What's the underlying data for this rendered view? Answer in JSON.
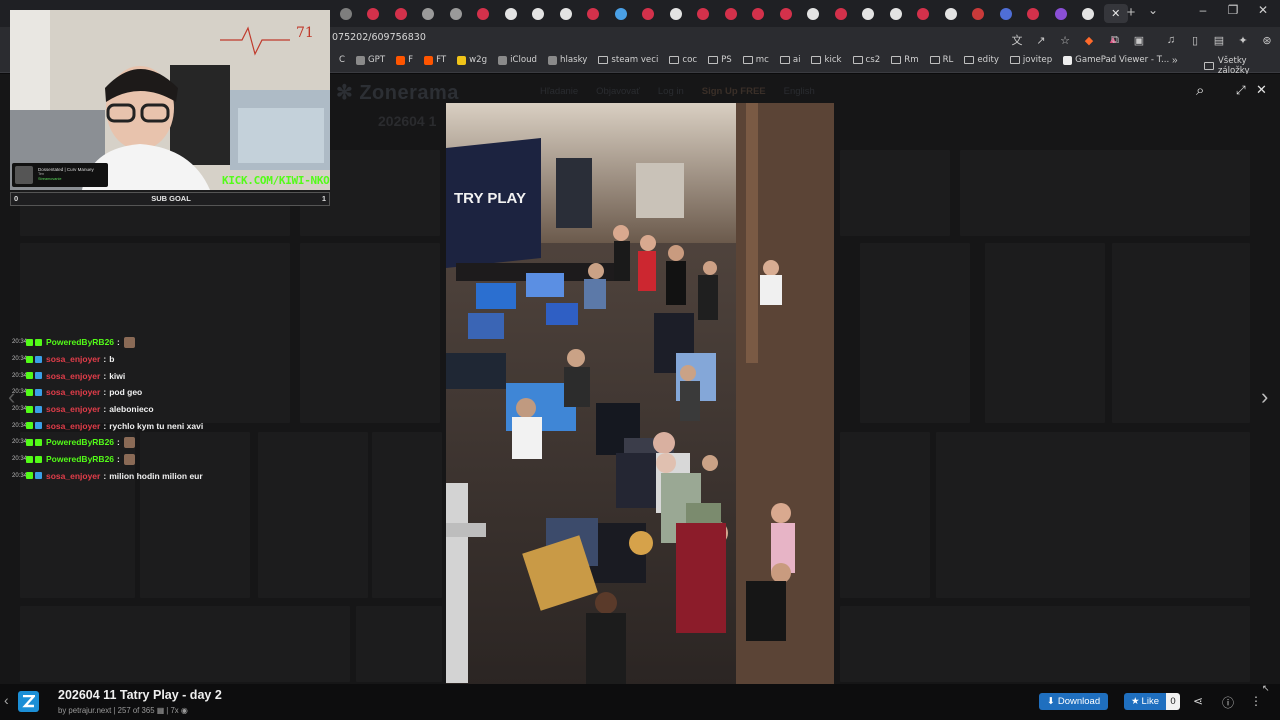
{
  "browser": {
    "url": "075202/609756830",
    "tab_colors": [
      "#7e7e7e",
      "#d3314b",
      "#d3314b",
      "#9a9a9a",
      "#9a9a9a",
      "#d3314b",
      "#e3e3e3",
      "#e3e3e3",
      "#e3e3e3",
      "#d3314b",
      "#4aa0e6",
      "#d3314b",
      "#e3e3e3",
      "#d3314b",
      "#d3314b",
      "#d3314b",
      "#d3314b",
      "#e3e3e3",
      "#d3314b",
      "#e3e3e3",
      "#e3e3e3",
      "#d3314b",
      "#e3e3e3",
      "#c93a3a",
      "#4f6ed6",
      "#d3314b",
      "#8a4fd6",
      "#e3e3e3"
    ],
    "bookmarks": [
      {
        "label": "C",
        "icon": "letter-icon"
      },
      {
        "label": "GPT",
        "icon": "chatgpt-icon"
      },
      {
        "label": "F",
        "icon": "faceit-icon"
      },
      {
        "label": "FT",
        "icon": "ft-icon"
      },
      {
        "label": "w2g",
        "icon": "w2g-icon"
      },
      {
        "label": "iCloud",
        "icon": "apple-icon"
      },
      {
        "label": "hlasky",
        "icon": "image-icon"
      },
      {
        "label": "steam veci",
        "icon": "folder-icon"
      },
      {
        "label": "coc",
        "icon": "folder-icon"
      },
      {
        "label": "PS",
        "icon": "folder-icon"
      },
      {
        "label": "mc",
        "icon": "folder-icon"
      },
      {
        "label": "ai",
        "icon": "folder-icon"
      },
      {
        "label": "kick",
        "icon": "folder-icon"
      },
      {
        "label": "cs2",
        "icon": "folder-icon"
      },
      {
        "label": "Rm",
        "icon": "folder-icon"
      },
      {
        "label": "RL",
        "icon": "folder-icon"
      },
      {
        "label": "edity",
        "icon": "folder-icon"
      },
      {
        "label": "jovitep",
        "icon": "folder-icon"
      },
      {
        "label": "GamePad Viewer - T...",
        "icon": "gamepad-icon"
      }
    ],
    "bookmarks_more": "»",
    "all_bookmarks": "Všetky záložky"
  },
  "site": {
    "logo": "Zonerama",
    "nav": [
      "Hľadanie",
      "Objavovať",
      "Log in",
      "Sign Up FREE",
      "English"
    ],
    "dim_title": "202604 1"
  },
  "photo": {
    "title": "202604 11 Tatry Play - day 2",
    "author": "by petrajur.next",
    "position": "257 of 365",
    "views": "7x",
    "download_label": "Download",
    "like_label": "Like",
    "like_count": "0",
    "banner_text": "TRY PLAY"
  },
  "stream": {
    "heart_rate": "71",
    "kick_url": "KICK.COM/KIWI-NKO",
    "sub_goal_label": "SUB GOAL",
    "sub_goal_current": "0",
    "sub_goal_target": "1",
    "banner_name": "Dossentated | Curv Manuey",
    "banner_sub": "Ten",
    "banner_sub2": "Streamovanie"
  },
  "chat": [
    {
      "time": "20:34",
      "user": "PoweredByRB26",
      "color": "#53fc18",
      "badge": "#53fc18",
      "text": "",
      "emote": true
    },
    {
      "time": "20:34",
      "user": "sosa_enjoyer",
      "color": "#e33d4a",
      "badge": "#3aa0e8",
      "text": "b",
      "emote": false
    },
    {
      "time": "20:34",
      "user": "sosa_enjoyer",
      "color": "#e33d4a",
      "badge": "#3aa0e8",
      "text": "kiwi",
      "emote": false
    },
    {
      "time": "20:34",
      "user": "sosa_enjoyer",
      "color": "#e33d4a",
      "badge": "#3aa0e8",
      "text": "pod geo",
      "emote": false
    },
    {
      "time": "20:34",
      "user": "sosa_enjoyer",
      "color": "#e33d4a",
      "badge": "#3aa0e8",
      "text": "alebonieco",
      "emote": false
    },
    {
      "time": "20:34",
      "user": "sosa_enjoyer",
      "color": "#e33d4a",
      "badge": "#3aa0e8",
      "text": "rychlo kym tu neni xavi",
      "emote": false
    },
    {
      "time": "20:34",
      "user": "PoweredByRB26",
      "color": "#53fc18",
      "badge": "#53fc18",
      "text": "",
      "emote": true
    },
    {
      "time": "20:34",
      "user": "PoweredByRB26",
      "color": "#53fc18",
      "badge": "#53fc18",
      "text": "",
      "emote": true
    },
    {
      "time": "20:34",
      "user": "sosa_enjoyer",
      "color": "#e33d4a",
      "badge": "#3aa0e8",
      "text": "milion hodin milion eur",
      "emote": false
    }
  ]
}
